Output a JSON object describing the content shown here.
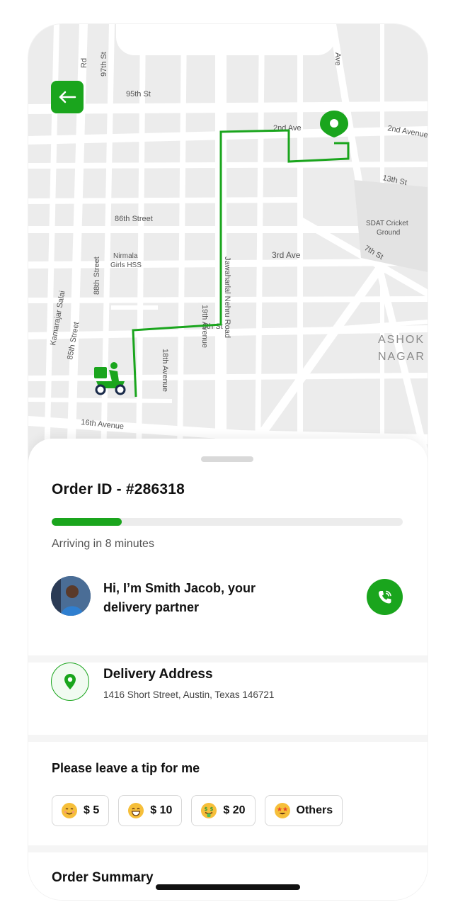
{
  "map": {
    "street_labels": [
      "97th St",
      "95th St",
      "2nd Ave",
      "2nd Avenue",
      "13th St",
      "86th Street",
      "SDAT Cricket",
      "Ground",
      "7th St",
      "3rd Ave",
      "Nirmala",
      "Girls HSS",
      "88th Street",
      "19th Avenue",
      "Kamarajar Salai",
      "85th Street",
      "8th St",
      "Jawaharlal Nehru Road",
      "18th Avenue",
      "ASHOK",
      "NAGAR",
      "16th Avenue",
      "Rd",
      "Ave"
    ],
    "route_color": "#1aa51d"
  },
  "header": {
    "back_icon": "arrow-left-icon"
  },
  "order": {
    "id_label": "Order ID - #286318",
    "progress": 0.2,
    "arriving_text": "Arriving in 8 minutes"
  },
  "partner": {
    "line1": "Hi, I’m Smith Jacob, your",
    "line2": "delivery partner",
    "call_icon": "phone-call-icon"
  },
  "address": {
    "title": "Delivery Address",
    "text": "1416 Short Street, Austin, Texas 146721",
    "icon": "location-pin-icon"
  },
  "tip": {
    "title": "Please leave a tip for me",
    "options": [
      {
        "label": "$ 5",
        "icon": "smiling-face-icon"
      },
      {
        "label": "$ 10",
        "icon": "grinning-face-icon"
      },
      {
        "label": "$ 20",
        "icon": "money-mouth-face-icon"
      },
      {
        "label": "Others",
        "icon": "star-struck-face-icon"
      }
    ]
  },
  "summary": {
    "title": "Order Summary"
  },
  "colors": {
    "accent": "#1aa51d",
    "map_bg": "#efefef",
    "road": "#ffffff"
  }
}
